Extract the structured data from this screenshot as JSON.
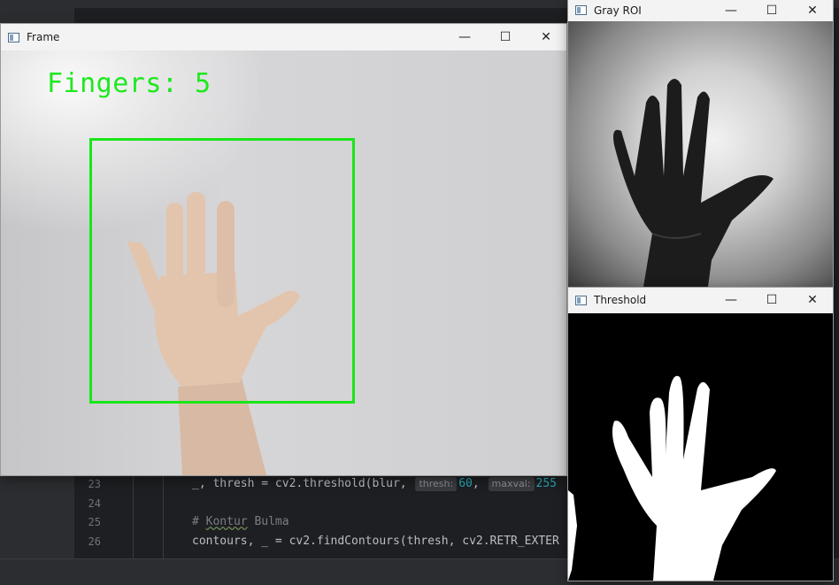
{
  "ide": {
    "lines": [
      {
        "number": "23",
        "prefix": "_, thresh = cv2.threshold(blur, ",
        "hint1": "thresh:",
        "val1": "60",
        "sep": ", ",
        "hint2": "maxval:",
        "val2": "255"
      },
      {
        "number": "24",
        "text": ""
      },
      {
        "number": "25",
        "comment_hash": "# ",
        "comment_word1": "Kontur",
        "comment_word2": " Bulma"
      },
      {
        "number": "26",
        "text": "contours, _ = cv2.findContours(thresh, cv2.RETR_EXTER"
      }
    ]
  },
  "windows": {
    "frame": {
      "title": "Frame",
      "overlay_text": "Fingers: 5"
    },
    "gray_roi": {
      "title": "Gray ROI"
    },
    "threshold": {
      "title": "Threshold"
    }
  },
  "controls": {
    "minimize": "—",
    "maximize": "☐",
    "close": "✕"
  },
  "colors": {
    "overlay_green": "#19e619"
  }
}
